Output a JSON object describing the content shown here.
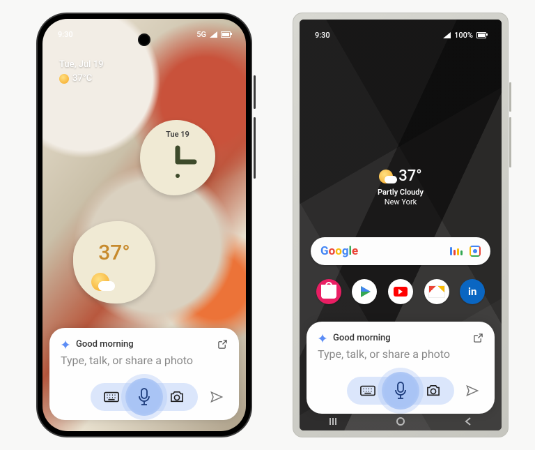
{
  "phoneA": {
    "status": {
      "time": "9:30",
      "net": "5G"
    },
    "date": "Tue, Jul 19",
    "temp": "37°C",
    "clockWidget": {
      "dayLabel": "Tue 19"
    },
    "weatherWidget": {
      "temp": "37°"
    }
  },
  "phoneB": {
    "status": {
      "time": "9:30",
      "battery": "100%"
    },
    "weather": {
      "temp": "37°",
      "cond": "Partly Cloudy",
      "loc": "New York"
    }
  },
  "gemini": {
    "greeting": "Good morning",
    "placeholder": "Type, talk, or share a photo"
  },
  "apps": {
    "a1": "shopping",
    "a2": "play-store",
    "a3": "youtube",
    "a4": "gmail",
    "a5": "in"
  }
}
